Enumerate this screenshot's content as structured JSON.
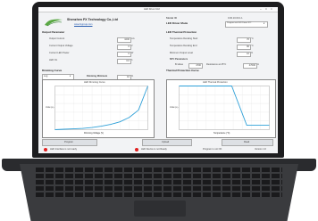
{
  "window": {
    "title": "LED Driver GUI"
  },
  "company": {
    "name": "Shenzhen FX Technology Co.,Ltd",
    "website": "www.fxgroup.com"
  },
  "device": {
    "model_label": "Model ID",
    "model_value": "0.00.10.00.1.1",
    "mode_label": "LED Driver Mode",
    "mode_value": "Program via LED Driver IPC"
  },
  "output": {
    "title": "Output Parameter",
    "rows": [
      {
        "label": "Output Current",
        "value": "1000",
        "unit": "mA"
      },
      {
        "label": "Current Output Voltage",
        "value": "0",
        "unit": "V"
      },
      {
        "label": "Current LED Power",
        "value": "0",
        "unit": "W"
      },
      {
        "label": "LED On",
        "value": "0.0",
        "unit": "h"
      }
    ]
  },
  "thermal": {
    "title": "LED Thermal Protection",
    "rows": [
      {
        "label": "Temperature Derating Start",
        "value": "70",
        "unit": "°C"
      },
      {
        "label": "Temperature Derating End",
        "value": "90",
        "unit": "°C"
      },
      {
        "label": "Minimum Output Level",
        "value": "10",
        "unit": "%"
      }
    ],
    "ntc_title": "NTC Parameters",
    "ntc_b_label": "B-Value",
    "ntc_b_value": "4700",
    "ntc_r_label": "Resistance at 25°C",
    "ntc_r_value": "47000",
    "ntc_r_unit": "Ω"
  },
  "dimming": {
    "title": "Dimming Curve",
    "curve_value": "Log",
    "min_label": "Dimming Minimum",
    "min_value": "10",
    "min_unit": "%",
    "chart_title": "LED Dimming Curve",
    "xlabel": "Dimming Voltage (V)",
    "ylabel": "PWM (%)"
  },
  "thermal_curve": {
    "title": "Thermal Protection Curve",
    "chart_title": "LED Thermal Protection",
    "xlabel": "Temperature (°C)",
    "ylabel": "PWM (%)"
  },
  "buttons": {
    "program": "Program",
    "upload": "Upload",
    "read": "Read"
  },
  "status": {
    "led1": "LED Interface is not ready",
    "led2": "LED Device is not Ready",
    "program_status": "Program is not OK",
    "version": "Version 1.0"
  },
  "colors": {
    "curve": "#2fa0d8",
    "led_red": "#e02020",
    "bezel": "#1d1d1f"
  },
  "chart_data": [
    {
      "type": "line",
      "title": "LED Dimming Curve",
      "xlabel": "Dimming Voltage (V)",
      "ylabel": "PWM (%)",
      "x": [
        0,
        1,
        2,
        3,
        4,
        5,
        6,
        7,
        8,
        9,
        10
      ],
      "values": [
        0,
        1,
        2,
        3,
        5,
        8,
        12,
        18,
        28,
        45,
        100
      ],
      "ylim": [
        0,
        100
      ],
      "xlim": [
        0,
        10
      ]
    },
    {
      "type": "line",
      "title": "LED Thermal Protection",
      "xlabel": "Temperature (°C)",
      "ylabel": "PWM (%)",
      "x": [
        0,
        70,
        90,
        120
      ],
      "values": [
        100,
        100,
        10,
        10
      ],
      "ylim": [
        0,
        100
      ],
      "xlim": [
        0,
        120
      ]
    }
  ]
}
